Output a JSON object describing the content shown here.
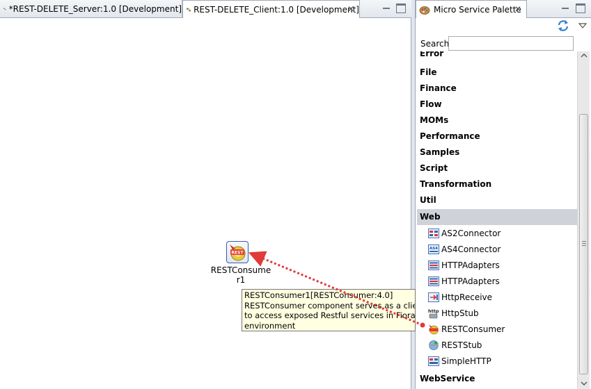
{
  "editor": {
    "tabs": [
      {
        "label": "*REST-DELETE_Server:1.0 [Development]",
        "active": false
      },
      {
        "label": "REST-DELETE_Client:1.0 [Development]",
        "active": true
      }
    ]
  },
  "canvas": {
    "component": {
      "label": "RESTConsumer1",
      "label_line1": "RESTConsume",
      "label_line2": "r1",
      "icon": "rest-consumer-icon"
    },
    "tooltip": {
      "line1": "RESTConsumer1[RESTConsumer:4.0]",
      "line2": "RESTConsumer component serves as a client",
      "line3": "to access exposed Restful services in Fiorano",
      "line4": "environment"
    }
  },
  "palette": {
    "title": "Micro Service Palette",
    "search_label": "Search",
    "search_value": "",
    "categories": [
      "Error",
      "File",
      "Finance",
      "Flow",
      "MOMs",
      "Performance",
      "Samples",
      "Script",
      "Transformation",
      "Util",
      "Web"
    ],
    "selected_category": "Web",
    "web_items": [
      {
        "label": "AS2Connector",
        "icon": "as2-icon"
      },
      {
        "label": "AS4Connector",
        "icon": "as4-icon"
      },
      {
        "label": "HTTPAdapters",
        "icon": "http-adapter-icon"
      },
      {
        "label": "HTTPAdapters",
        "icon": "http-adapter-icon"
      },
      {
        "label": "HttpReceive",
        "icon": "http-receive-icon"
      },
      {
        "label": "HttpStub",
        "icon": "http-stub-icon"
      },
      {
        "label": "RESTConsumer",
        "icon": "rest-consumer-icon"
      },
      {
        "label": "RESTStub",
        "icon": "rest-stub-icon"
      },
      {
        "label": "SimpleHTTP",
        "icon": "simple-http-icon"
      }
    ],
    "after_category": "WebService"
  },
  "colors": {
    "selection": "#cfd3d9",
    "tooltip_bg": "#ffffe1",
    "drag_arrow": "#e03a3a"
  }
}
